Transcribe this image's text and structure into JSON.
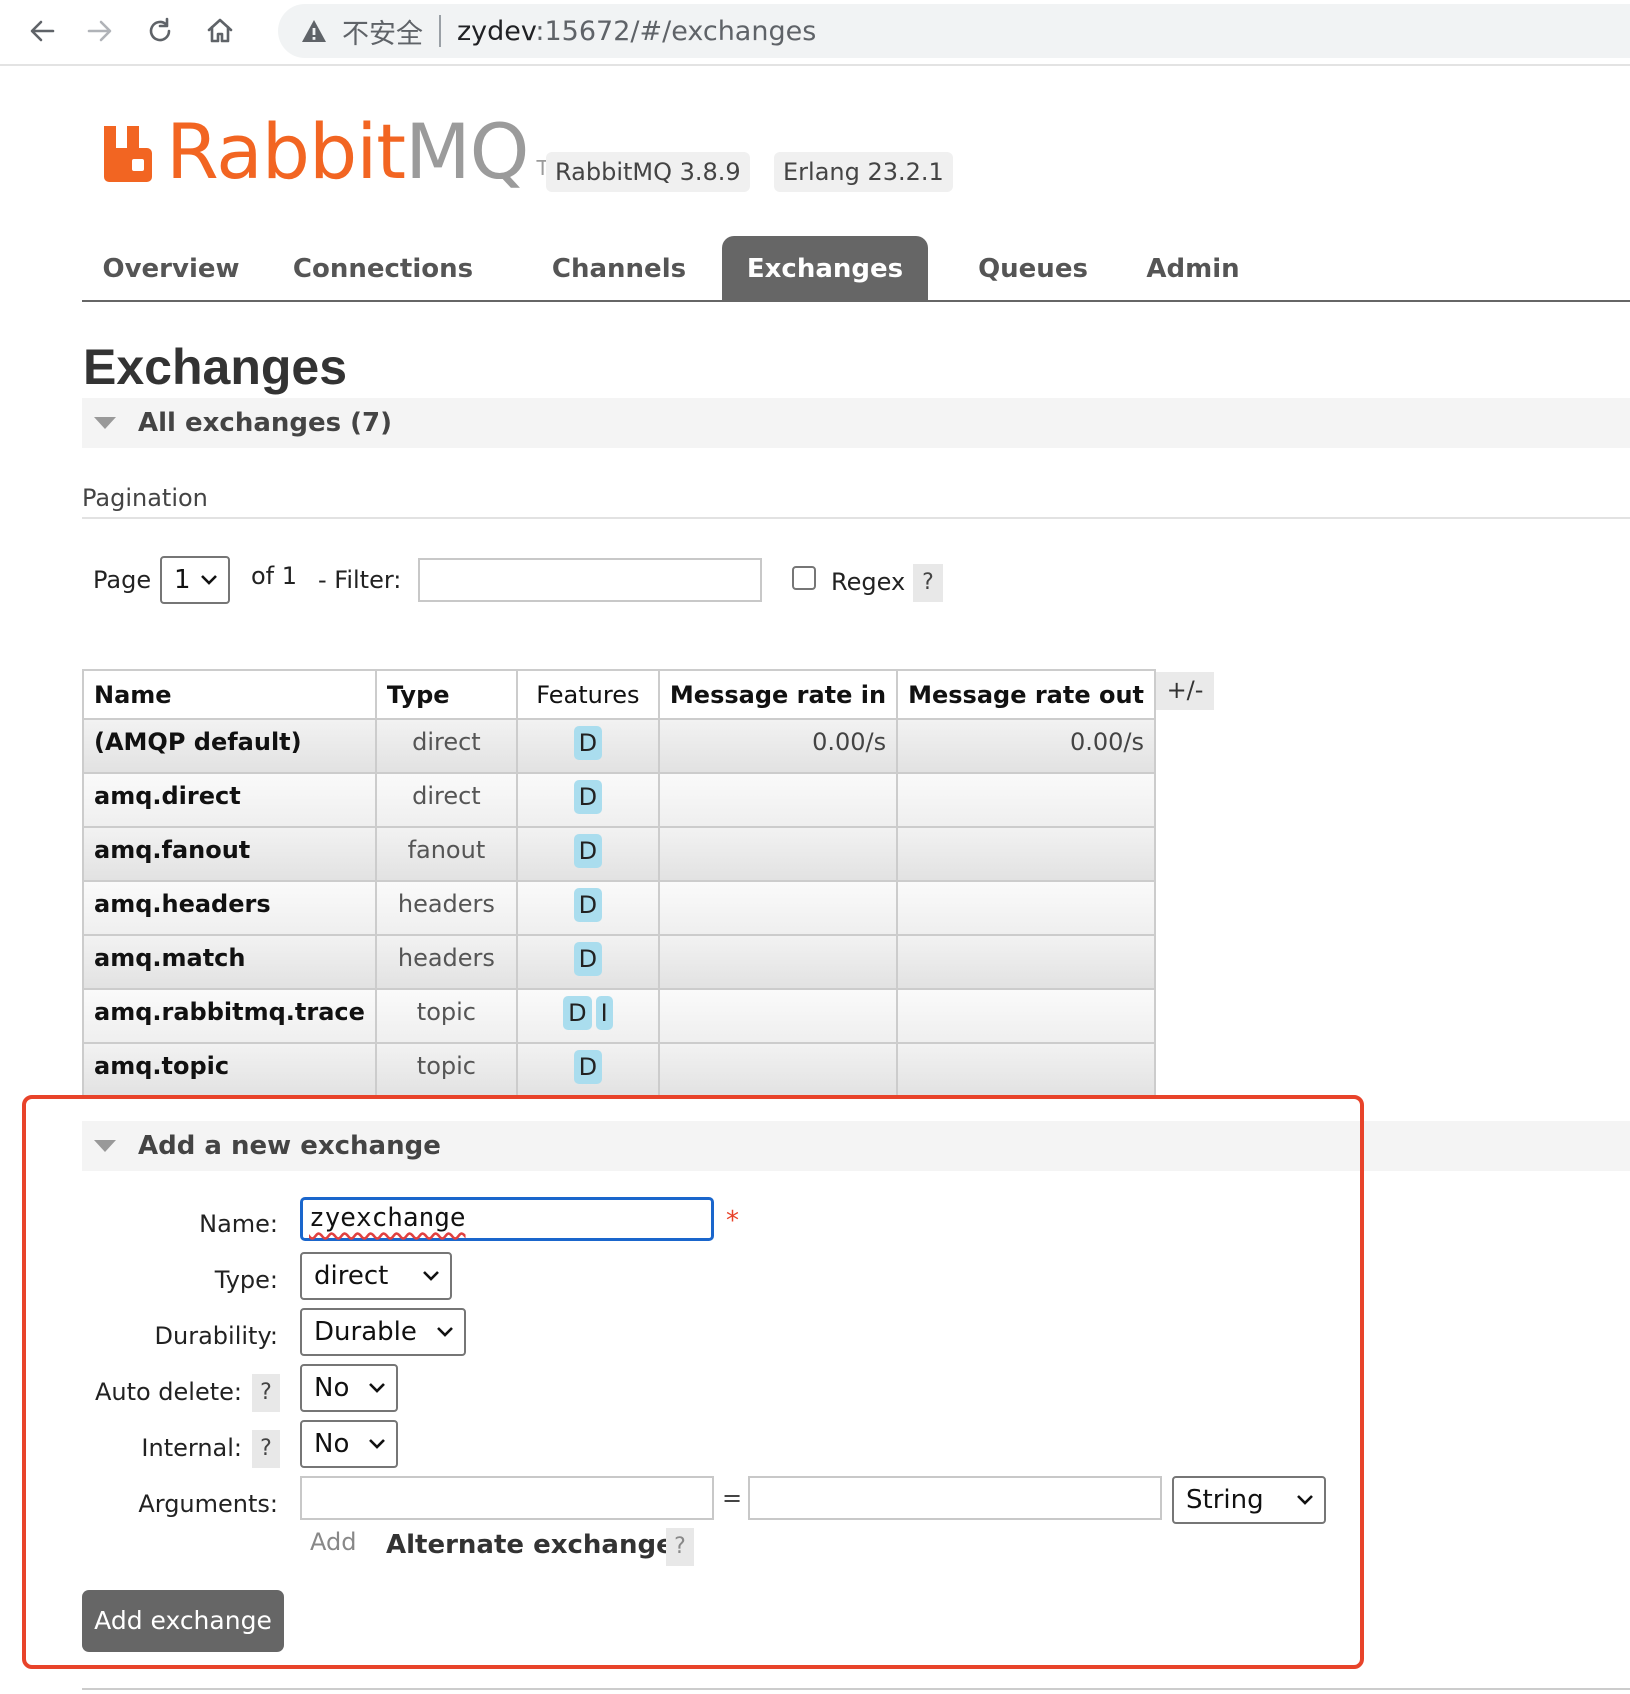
{
  "browser": {
    "security_label": "不安全",
    "url_host": "zydev",
    "url_rest": ":15672/#/exchanges"
  },
  "header": {
    "logo_rabbit": "Rabbit",
    "logo_mq": "MQ",
    "logo_tm": "TM",
    "version": "RabbitMQ 3.8.9",
    "erlang": "Erlang 23.2.1",
    "brand_color": "#f26522"
  },
  "nav": {
    "tabs": [
      {
        "label": "Overview"
      },
      {
        "label": "Connections"
      },
      {
        "label": "Channels"
      },
      {
        "label": "Exchanges",
        "active": true
      },
      {
        "label": "Queues"
      },
      {
        "label": "Admin"
      }
    ]
  },
  "page": {
    "title": "Exchanges",
    "all_section": "All exchanges (7)"
  },
  "pagination": {
    "label": "Pagination",
    "page_label": "Page",
    "page_value": "1",
    "of_label": "of 1",
    "filter_label": "- Filter:",
    "filter_value": "",
    "regex_label": "Regex",
    "regex_checked": false,
    "help": "?"
  },
  "table": {
    "headers": [
      "Name",
      "Type",
      "Features",
      "Message rate in",
      "Message rate out"
    ],
    "column_toggle": "+/-",
    "rows": [
      {
        "name": "(AMQP default)",
        "type": "direct",
        "features": "D",
        "rate_in": "0.00/s",
        "rate_out": "0.00/s"
      },
      {
        "name": "amq.direct",
        "type": "direct",
        "features": "D",
        "rate_in": "",
        "rate_out": ""
      },
      {
        "name": "amq.fanout",
        "type": "fanout",
        "features": "D",
        "rate_in": "",
        "rate_out": ""
      },
      {
        "name": "amq.headers",
        "type": "headers",
        "features": "D",
        "rate_in": "",
        "rate_out": ""
      },
      {
        "name": "amq.match",
        "type": "headers",
        "features": "D",
        "rate_in": "",
        "rate_out": ""
      },
      {
        "name": "amq.rabbitmq.trace",
        "type": "topic",
        "features": "D",
        "features2": "I",
        "rate_in": "",
        "rate_out": ""
      },
      {
        "name": "amq.topic",
        "type": "topic",
        "features": "D",
        "rate_in": "",
        "rate_out": ""
      }
    ]
  },
  "add_form": {
    "section": "Add a new exchange",
    "name_label": "Name:",
    "name_value": "zyexchange",
    "required_mark": "*",
    "type_label": "Type:",
    "type_value": "direct",
    "durability_label": "Durability:",
    "durability_value": "Durable",
    "auto_delete_label": "Auto delete:",
    "auto_delete_value": "No",
    "internal_label": "Internal:",
    "internal_value": "No",
    "arguments_label": "Arguments:",
    "arg_key": "",
    "equals": "=",
    "arg_value": "",
    "arg_type": "String",
    "add_link": "Add",
    "alternate_exchange": "Alternate exchange",
    "help": "?",
    "submit": "Add exchange",
    "highlight_color": "#e8432a"
  }
}
